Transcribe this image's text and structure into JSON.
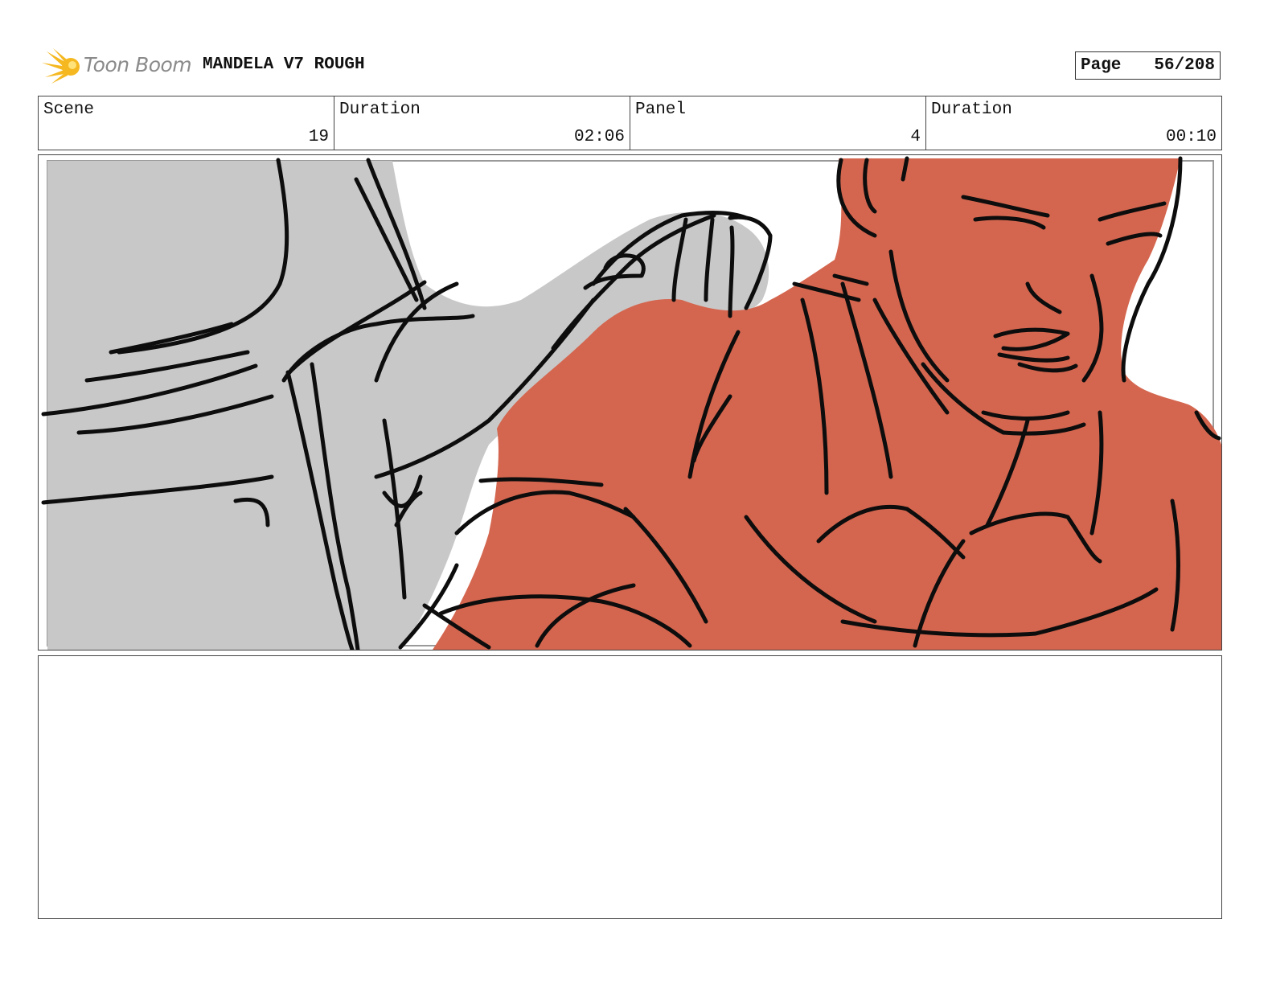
{
  "header": {
    "brand": "Toon Boom",
    "title": "MANDELA V7 ROUGH",
    "page_label": "Page",
    "page_value": "56/208"
  },
  "info": {
    "scene_label": "Scene",
    "scene_value": "19",
    "scene_duration_label": "Duration",
    "scene_duration_value": "02:06",
    "panel_label": "Panel",
    "panel_value": "4",
    "panel_duration_label": "Duration",
    "panel_duration_value": "00:10"
  },
  "colors": {
    "logo": "#f5b820",
    "skin_red": "#d4664f",
    "gray_fill": "#c8c8c8",
    "ink": "#0d0d0d"
  },
  "notes": {
    "text": ""
  }
}
